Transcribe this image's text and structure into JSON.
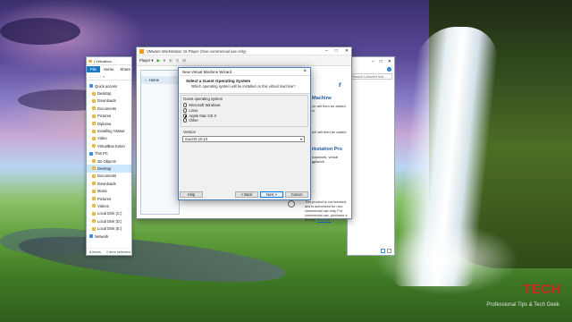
{
  "explorer": {
    "title": "| Virtualbox …",
    "ribbon": {
      "file": "File",
      "home": "Home",
      "share": "Share"
    },
    "address": "«",
    "nav": [
      {
        "label": "Quick access",
        "head": true
      },
      {
        "label": "Desktop"
      },
      {
        "label": "Downloads"
      },
      {
        "label": "Documents"
      },
      {
        "label": "Pictures"
      },
      {
        "label": "Diploma"
      },
      {
        "label": "Installing VMwar"
      },
      {
        "label": "Video"
      },
      {
        "label": "VirtualBox Exten"
      },
      {
        "label": "This PC",
        "head": true
      },
      {
        "label": "3D Objects"
      },
      {
        "label": "Desktop",
        "selected": true
      },
      {
        "label": "Documents"
      },
      {
        "label": "Downloads"
      },
      {
        "label": "Music"
      },
      {
        "label": "Pictures"
      },
      {
        "label": "Videos"
      },
      {
        "label": "Local Disk (C:)"
      },
      {
        "label": "Local Disk (D:)"
      },
      {
        "label": "Local Disk (E:)"
      },
      {
        "label": "Network",
        "head": true
      }
    ],
    "status_items": "8 items",
    "status_selected": "1 item selected"
  },
  "explorer_right": {
    "search": "Search Unlocker Inst…",
    "help": "?"
  },
  "vmware": {
    "title": "VMware Workstation 15 Player (Non-commercial use only)",
    "player_menu": "Player ▾",
    "sidebar_home": "Home",
    "frag_r": "r",
    "frag_machine": "Machine",
    "frag_machine_text": "ch will then be added to",
    "frag_added": "ich will then be added",
    "frag_pro": "rkstation Pro",
    "frag_pro_text1": "napshots, virtual network",
    "frag_pro_text2": "re.",
    "license_text1": "This product is not licensed and is authorized for non-",
    "license_text2": "commercial use only. For commercial use, purchase a",
    "license_text3": "license.",
    "license_link": "Buy now."
  },
  "wizard": {
    "title": "New Virtual Machine Wizard",
    "close": "×",
    "heading": "Select a Guest Operating System",
    "subheading": "Which operating system will be installed on this virtual machine?",
    "group_label": "Guest operating system",
    "options": [
      {
        "label": "Microsoft Windows",
        "selected": false
      },
      {
        "label": "Linux",
        "selected": false
      },
      {
        "label": "Apple Mac OS X",
        "selected": true
      },
      {
        "label": "Other",
        "selected": false
      }
    ],
    "version_label": "Version",
    "version_value": "macOS 10.13",
    "buttons": {
      "help": "Help",
      "back": "< Back",
      "next": "Next >",
      "cancel": "Cancel"
    }
  },
  "watermark": {
    "logo": "TECH",
    "tagline": "Professional Tips & Tech Geek"
  }
}
